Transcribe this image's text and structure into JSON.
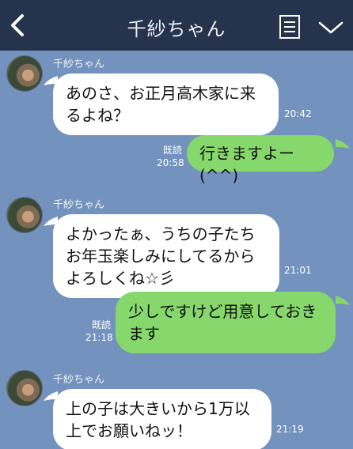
{
  "header": {
    "title": "千紗ちゃん",
    "back_icon": "chevron-left-icon",
    "menu_icon": "notes-icon",
    "dropdown_icon": "chevron-down-icon"
  },
  "colors": {
    "chat_background": "#7393be",
    "header_background": "#26334d",
    "incoming_bubble": "#ffffff",
    "outgoing_bubble": "#86d86c"
  },
  "messages": [
    {
      "sender": "千紗ちゃん",
      "direction": "incoming",
      "lines": [
        "あのさ、お正月高木家に来",
        "るよね？"
      ],
      "time": "20:42"
    },
    {
      "direction": "outgoing",
      "lines": [
        "行きますよー(^^)"
      ],
      "read": "既読",
      "time": "20:58"
    },
    {
      "sender": "千紗ちゃん",
      "direction": "incoming",
      "lines": [
        "よかったぁ、うちの子たち",
        "お年玉楽しみにしてるから",
        "よろしくね☆彡"
      ],
      "time": "21:01"
    },
    {
      "direction": "outgoing",
      "lines": [
        "少しですけど用意しておき",
        "ます"
      ],
      "read": "既読",
      "time": "21:18"
    },
    {
      "sender": "千紗ちゃん",
      "direction": "incoming",
      "lines": [
        "上の子は大きいから1万以",
        "上でお願いねッ！"
      ],
      "time": "21:19"
    }
  ]
}
